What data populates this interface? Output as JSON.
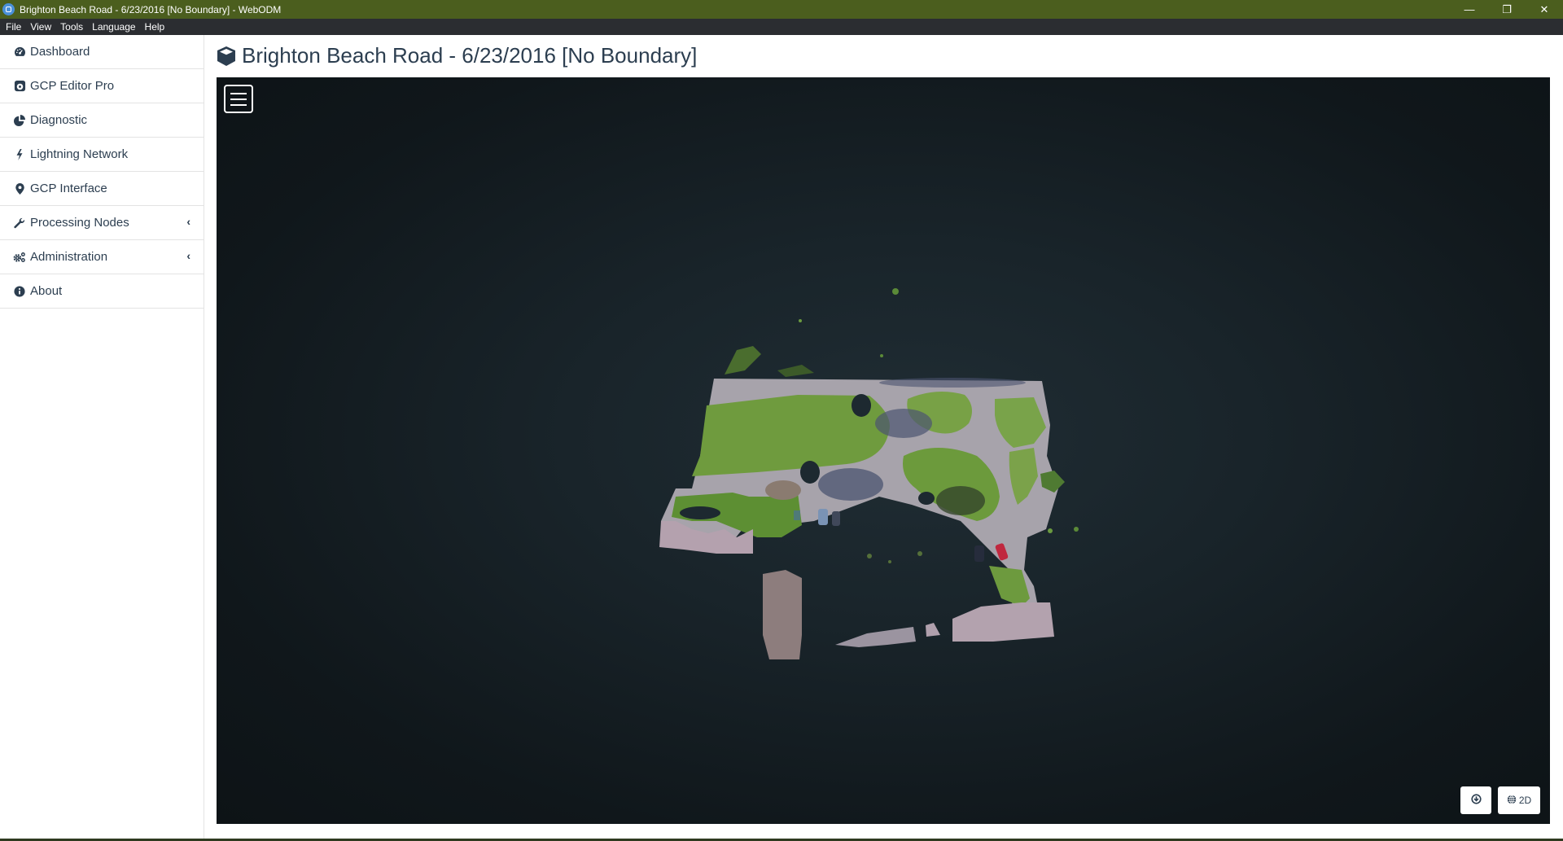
{
  "window": {
    "title": "Brighton Beach Road - 6/23/2016 [No Boundary] - WebODM",
    "controls": [
      "minimize",
      "restore",
      "close"
    ]
  },
  "menubar": {
    "items": [
      "File",
      "View",
      "Tools",
      "Language",
      "Help"
    ]
  },
  "sidebar": {
    "items": [
      {
        "label": "Dashboard",
        "icon": "dashboard-icon",
        "expandable": false
      },
      {
        "label": "GCP Editor Pro",
        "icon": "gcp-editor-icon",
        "expandable": false
      },
      {
        "label": "Diagnostic",
        "icon": "pie-chart-icon",
        "expandable": false
      },
      {
        "label": "Lightning Network",
        "icon": "bolt-icon",
        "expandable": false
      },
      {
        "label": "GCP Interface",
        "icon": "map-marker-icon",
        "expandable": false
      },
      {
        "label": "Processing Nodes",
        "icon": "wrench-icon",
        "expandable": true
      },
      {
        "label": "Administration",
        "icon": "cogs-icon",
        "expandable": true
      },
      {
        "label": "About",
        "icon": "info-circle-icon",
        "expandable": false
      }
    ]
  },
  "page": {
    "title": "Brighton Beach Road - 6/23/2016 [No Boundary]",
    "title_icon": "cube-icon"
  },
  "viewer": {
    "menu_button_icon": "hamburger-icon",
    "buttons": {
      "download_icon": "download-icon",
      "mode_icon": "globe-icon",
      "mode_label": "2D"
    },
    "colors": {
      "grass": "#6e9a3c",
      "road": "#a9a6ad",
      "gravel": "#b6a3ae",
      "background": "#1a252b"
    }
  }
}
